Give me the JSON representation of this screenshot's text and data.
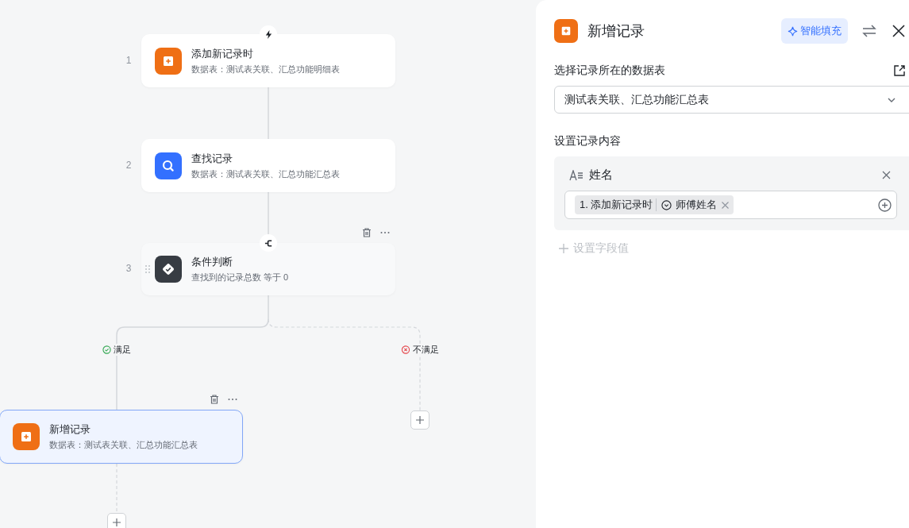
{
  "canvas": {
    "nodes": [
      {
        "step": "1",
        "kind": "trigger",
        "title": "添加新记录时",
        "subtitle": "数据表：测试表关联、汇总功能明细表",
        "selected": false,
        "toolbar": false
      },
      {
        "step": "2",
        "kind": "find",
        "title": "查找记录",
        "subtitle": "数据表：测试表关联、汇总功能汇总表",
        "selected": false,
        "toolbar": false
      },
      {
        "step": "3",
        "kind": "condition",
        "title": "条件判断",
        "subtitle": "查找到的记录总数 等于 0",
        "selected": false,
        "toolbar": true
      },
      {
        "kind": "add",
        "title": "新增记录",
        "subtitle": "数据表：测试表关联、汇总功能汇总表",
        "selected": true,
        "toolbar": true
      }
    ],
    "branches": [
      {
        "kind": "yes",
        "label": "满足"
      },
      {
        "kind": "no",
        "label": "不满足"
      }
    ]
  },
  "panel": {
    "title": "新增记录",
    "smart_fill": "智能填充",
    "table_label": "选择记录所在的数据表",
    "table_value": "测试表关联、汇总功能汇总表",
    "content_label": "设置记录内容",
    "fields": [
      {
        "name": "姓名",
        "tokens": [
          {
            "step": "1. 添加新记录时",
            "field": "师傅姓名"
          }
        ]
      }
    ],
    "add_field": "设置字段值"
  }
}
